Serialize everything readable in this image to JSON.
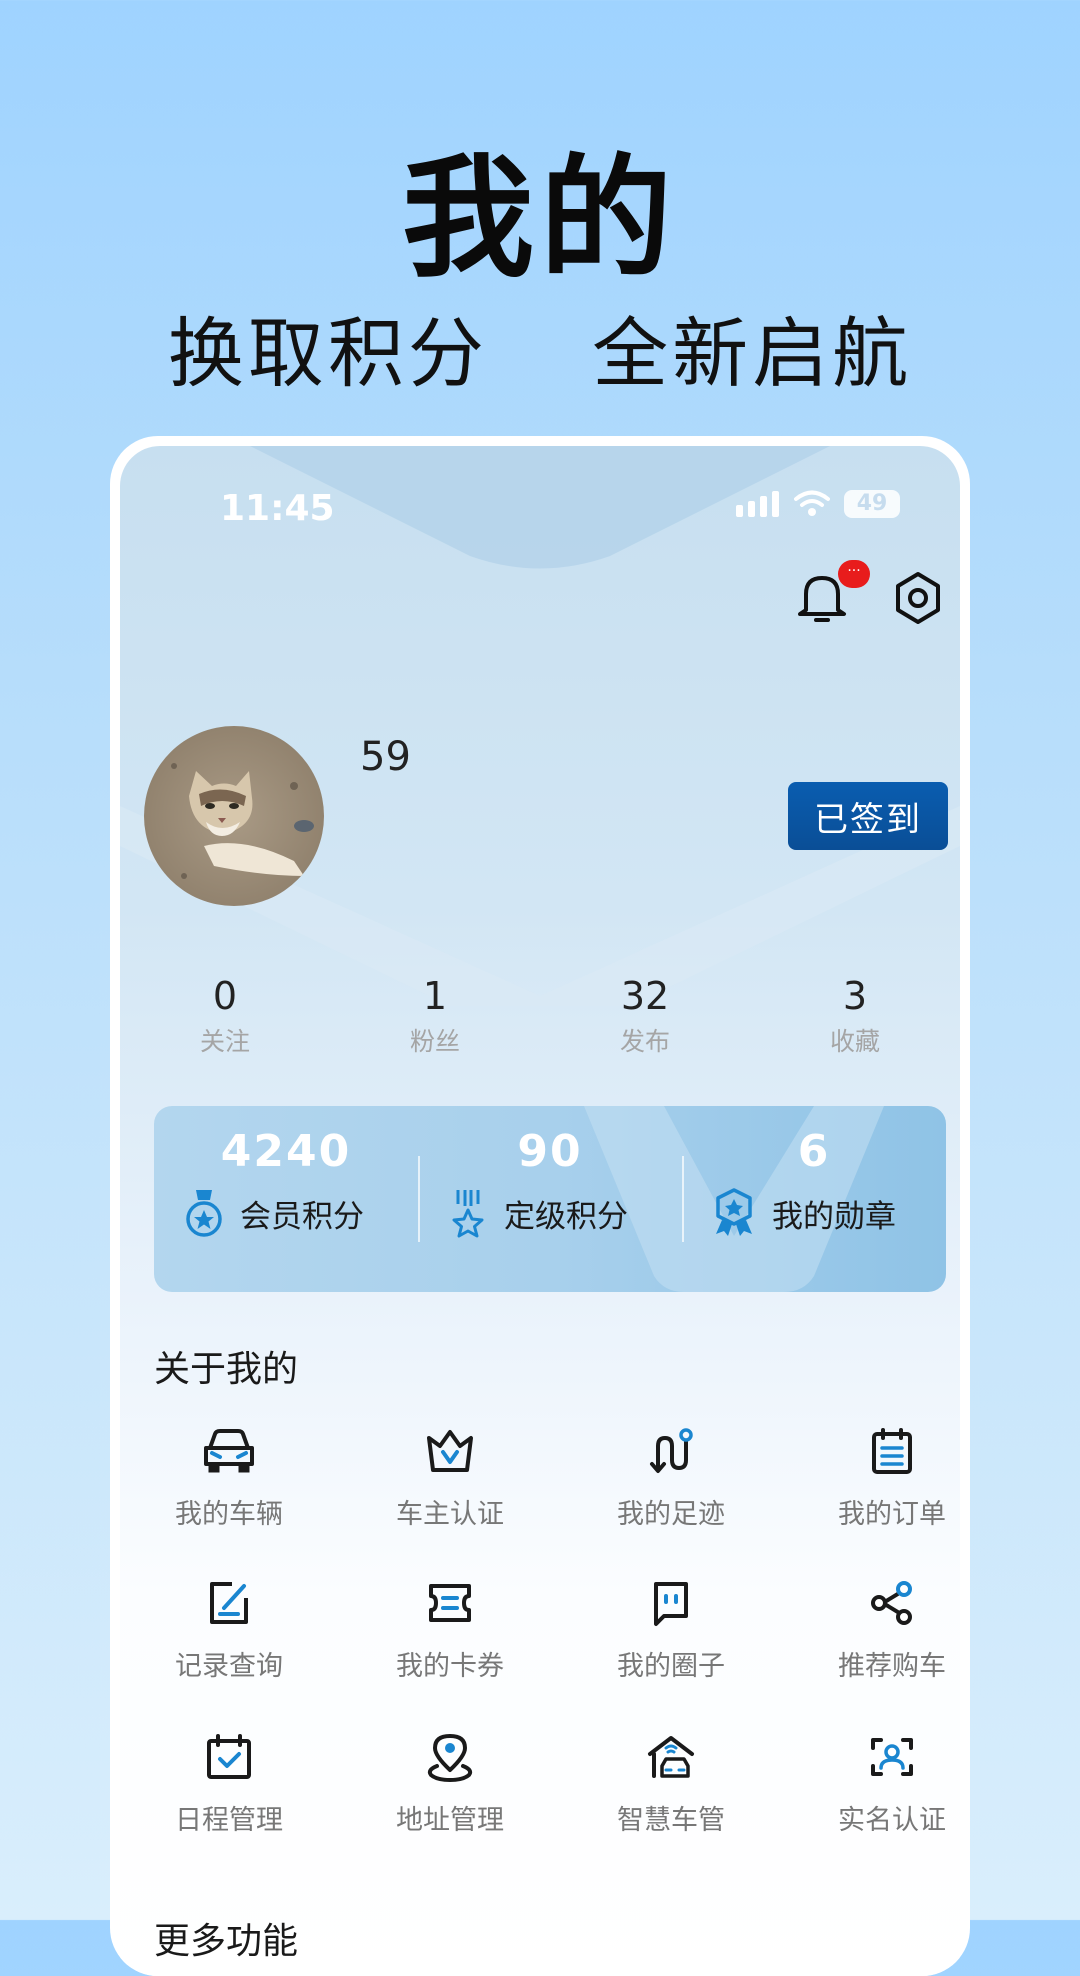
{
  "promo": {
    "title": "我的",
    "subtitle": "换取积分  全新启航"
  },
  "status_bar": {
    "time": "11:45",
    "battery": "49"
  },
  "header": {
    "notification_badge": "···"
  },
  "profile": {
    "username": "59",
    "checkin_label": "已签到"
  },
  "stats": [
    {
      "value": "0",
      "label": "关注"
    },
    {
      "value": "1",
      "label": "粉丝"
    },
    {
      "value": "32",
      "label": "发布"
    },
    {
      "value": "3",
      "label": "收藏"
    }
  ],
  "points": [
    {
      "value": "4240",
      "label": "会员积分",
      "icon": "medal-star-icon"
    },
    {
      "value": "90",
      "label": "定级积分",
      "icon": "ribbon-star-icon"
    },
    {
      "value": "6",
      "label": "我的勋章",
      "icon": "badge-award-icon"
    }
  ],
  "about": {
    "title": "关于我的",
    "items": [
      {
        "label": "我的车辆",
        "icon": "car-icon"
      },
      {
        "label": "车主认证",
        "icon": "crown-icon"
      },
      {
        "label": "我的足迹",
        "icon": "route-icon"
      },
      {
        "label": "我的订单",
        "icon": "clipboard-icon"
      },
      {
        "label": "记录查询",
        "icon": "edit-record-icon"
      },
      {
        "label": "我的卡券",
        "icon": "ticket-icon"
      },
      {
        "label": "我的圈子",
        "icon": "chat-bubble-icon"
      },
      {
        "label": "推荐购车",
        "icon": "share-icon"
      },
      {
        "label": "日程管理",
        "icon": "calendar-check-icon"
      },
      {
        "label": "地址管理",
        "icon": "location-pin-icon"
      },
      {
        "label": "智慧车管",
        "icon": "smart-garage-icon"
      },
      {
        "label": "实名认证",
        "icon": "user-scan-icon"
      }
    ]
  },
  "more": {
    "title": "更多功能"
  },
  "colors": {
    "accent": "#0a5db0",
    "icon_blue": "#1a86d0",
    "dark": "#1a1a1a"
  }
}
